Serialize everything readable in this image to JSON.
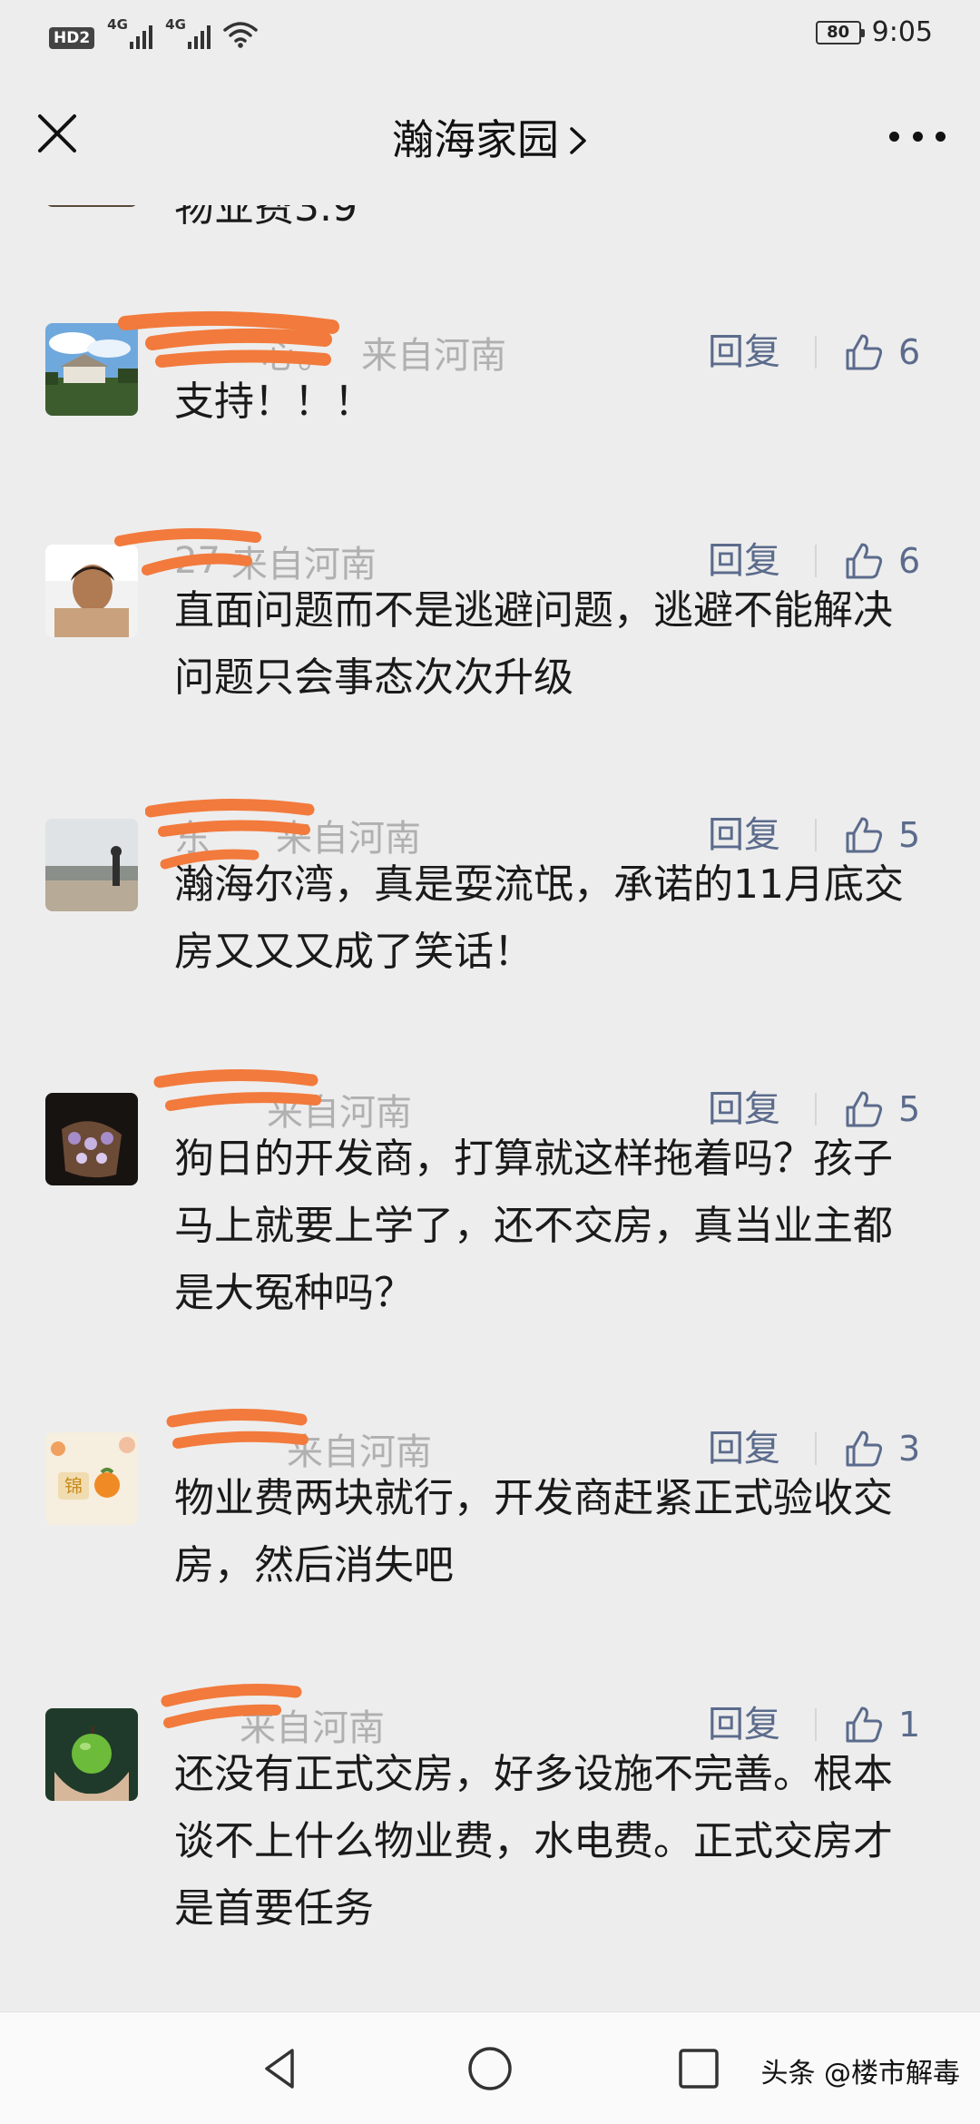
{
  "status_bar": {
    "hd_label": "HD2",
    "sim1_label": "4G",
    "sim2_label": "4G",
    "battery": "80",
    "time": "9:05"
  },
  "header": {
    "title": "瀚海家园",
    "chevron_icon": "chevron-right-icon",
    "close_icon": "close-icon",
    "more_icon": "more-dots-icon"
  },
  "partial_previous": {
    "text": "物业费3.9"
  },
  "comments": [
    {
      "nickname": "心。",
      "location": "来自河南",
      "reply_label": "回复",
      "likes": "6",
      "text": "支持！！！"
    },
    {
      "nickname": "27",
      "location": "来自河南",
      "reply_label": "回复",
      "likes": "6",
      "text": "直面问题而不是逃避问题，逃避不能解决问题只会事态次次升级"
    },
    {
      "nickname": "东",
      "location": "来自河南",
      "reply_label": "回复",
      "likes": "5",
      "text": "瀚海尔湾，真是耍流氓，承诺的11月底交房又又又成了笑话！"
    },
    {
      "nickname": "",
      "location": "来自河南",
      "reply_label": "回复",
      "likes": "5",
      "text": "狗日的开发商，打算就这样拖着吗？孩子马上就要上学了，还不交房，真当业主都是大冤种吗？"
    },
    {
      "nickname": "",
      "location": "来自河南",
      "reply_label": "回复",
      "likes": "3",
      "text": "物业费两块就行，开发商赶紧正式验收交房，然后消失吧"
    },
    {
      "nickname": "",
      "location": "来自河南",
      "reply_label": "回复",
      "likes": "1",
      "text": "还没有正式交房，好多设施不完善。根本谈不上什么物业费，水电费。正式交房才是首要任务"
    }
  ],
  "nav_bar": {
    "back_icon": "triangle-back-icon",
    "home_icon": "circle-home-icon",
    "recent_icon": "square-recents-icon"
  },
  "watermark": "头条 @楼市解毒",
  "colors": {
    "background": "#ededed",
    "link_blue": "#5b6b8c",
    "meta_gray": "#b0b0b0",
    "redaction_orange": "#f27a3c"
  }
}
